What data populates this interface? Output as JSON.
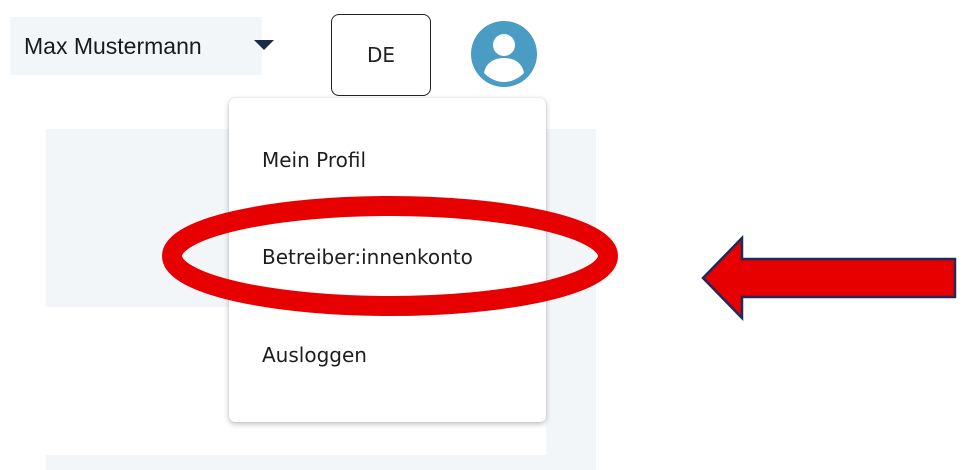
{
  "header": {
    "user_name": "Max Mustermann",
    "language": "DE"
  },
  "icons": {
    "user_caret": "caret-down-icon",
    "avatar": "user-avatar-icon",
    "annotation_arrow": "red-arrow-left"
  },
  "user_menu": {
    "items": [
      {
        "label": "Mein Profil"
      },
      {
        "label": "Betreiber:innenkonto"
      },
      {
        "label": "Ausloggen"
      }
    ]
  },
  "colors": {
    "avatar": "#4a9cc4",
    "highlight": "#e60000",
    "arrow_fill": "#e60000",
    "arrow_stroke": "#1f2a5a",
    "caret": "#1a2a48",
    "panel_background": "#f3f6f9"
  }
}
